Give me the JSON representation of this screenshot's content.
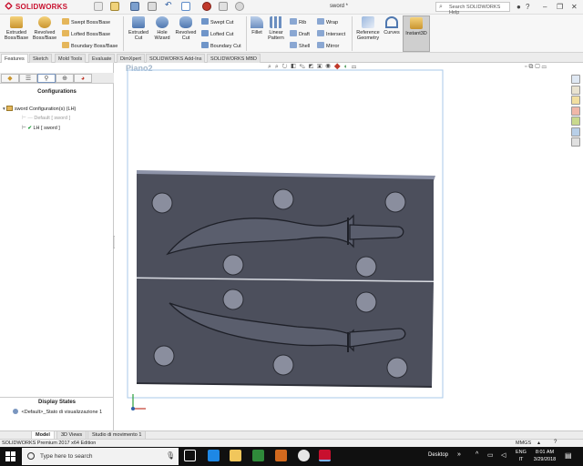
{
  "titlebar": {
    "brand": "SOLIDWORKS",
    "document_title": "sword *",
    "help_search_placeholder": "Search SOLIDWORKS Help"
  },
  "ribbon": {
    "big_buttons": [
      {
        "label1": "Extruded",
        "label2": "Boss/Base",
        "icon": "extruded-boss-icon"
      },
      {
        "label1": "Revolved",
        "label2": "Boss/Base",
        "icon": "revolved-boss-icon"
      },
      {
        "label1": "Extruded",
        "label2": "Cut",
        "icon": "extruded-cut-icon"
      },
      {
        "label1": "Hole",
        "label2": "Wizard",
        "icon": "hole-wizard-icon"
      },
      {
        "label1": "Revolved",
        "label2": "Cut",
        "icon": "revolved-cut-icon"
      },
      {
        "label1": "Fillet",
        "label2": "",
        "icon": "fillet-icon"
      },
      {
        "label1": "Linear",
        "label2": "Pattern",
        "icon": "linear-pattern-icon"
      },
      {
        "label1": "Reference",
        "label2": "Geometry",
        "icon": "reference-geometry-icon"
      },
      {
        "label1": "Curves",
        "label2": "",
        "icon": "curves-icon"
      },
      {
        "label1": "Instant3D",
        "label2": "",
        "icon": "instant3d-icon"
      }
    ],
    "small_group_1": [
      "Swept Boss/Base",
      "Lofted Boss/Base",
      "Boundary Boss/Base"
    ],
    "small_group_2": [
      "Swept Cut",
      "Lofted Cut",
      "Boundary Cut"
    ],
    "small_group_3": [
      "Rib",
      "Draft",
      "Shell"
    ],
    "small_group_4": [
      "Wrap",
      "Intersect",
      "Mirror"
    ]
  },
  "tabs": [
    "Features",
    "Sketch",
    "Mold Tools",
    "Evaluate",
    "DimXpert",
    "SOLIDWORKS Add-Ins",
    "SOLIDWORKS MBD"
  ],
  "active_tab": "Features",
  "left_panel": {
    "section_title": "Configurations",
    "root": "sword Configuration(s)  (LH)",
    "configs": [
      "Default [ sword ]",
      "LH [ sword ]"
    ],
    "display_states_title": "Display States",
    "display_state_item": "<Default>_Stato di visualizzazione 1"
  },
  "viewport": {
    "view_name": "Piano2",
    "model_color": "#4c4f5c",
    "selection_color": "#a9c8e8"
  },
  "bottom_tabs": [
    "Model",
    "3D Views",
    "Studio di movimento 1"
  ],
  "status": {
    "edition": "SOLIDWORKS Premium 2017 x64 Edition",
    "units": "MMGS"
  },
  "taskbar": {
    "search_placeholder": "Type here to search",
    "desktop_label": "Desktop",
    "lang_top": "ENG",
    "lang_bottom": "IT",
    "time": "8:01 AM",
    "date": "3/29/2018"
  }
}
